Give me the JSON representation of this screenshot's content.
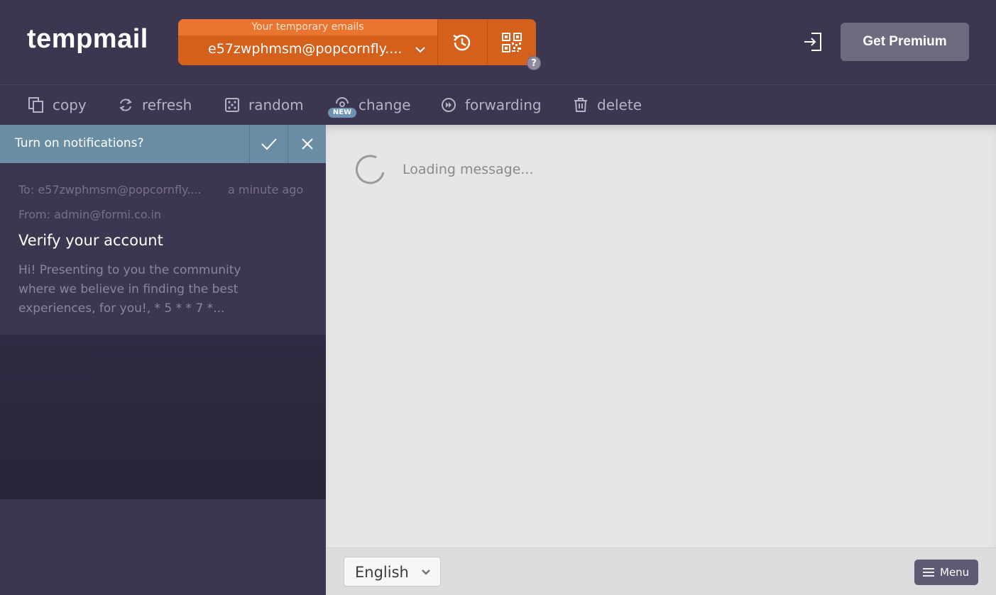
{
  "header": {
    "logo": "tempmail",
    "email_label": "Your temporary emails",
    "email_address": "e57zwphmsm@popcornfly....",
    "help_badge": "?",
    "premium_label": "Get Premium"
  },
  "toolbar": {
    "copy": "copy",
    "refresh": "refresh",
    "random": "random",
    "change": "change",
    "new_badge": "NEW",
    "forwarding": "forwarding",
    "delete": "delete"
  },
  "notification": {
    "text": "Turn on notifications?"
  },
  "inbox": {
    "items": [
      {
        "to": "To: e57zwphmsm@popcornfly....",
        "time": "a minute ago",
        "from": "From: admin@formi.co.in",
        "subject": "Verify your account",
        "preview": "Hi! Presenting to you the community where we believe in finding the best experiences, for you!, * 5 * * 7 *..."
      }
    ]
  },
  "message": {
    "loading_text": "Loading message..."
  },
  "footer": {
    "language": "English",
    "menu_label": "Menu"
  },
  "colors": {
    "header_bg": "#3d3650",
    "email_accent": "#d5601b",
    "notification_bg": "#6b8da3",
    "premium_bg": "#6f6a80"
  },
  "icons": [
    "history-icon",
    "qr-code-icon",
    "login-icon",
    "copy-icon",
    "refresh-icon",
    "dice-icon",
    "change-icon",
    "forward-icon",
    "trash-icon",
    "check-icon",
    "close-icon",
    "spinner-icon",
    "chevron-down-icon",
    "menu-icon"
  ]
}
